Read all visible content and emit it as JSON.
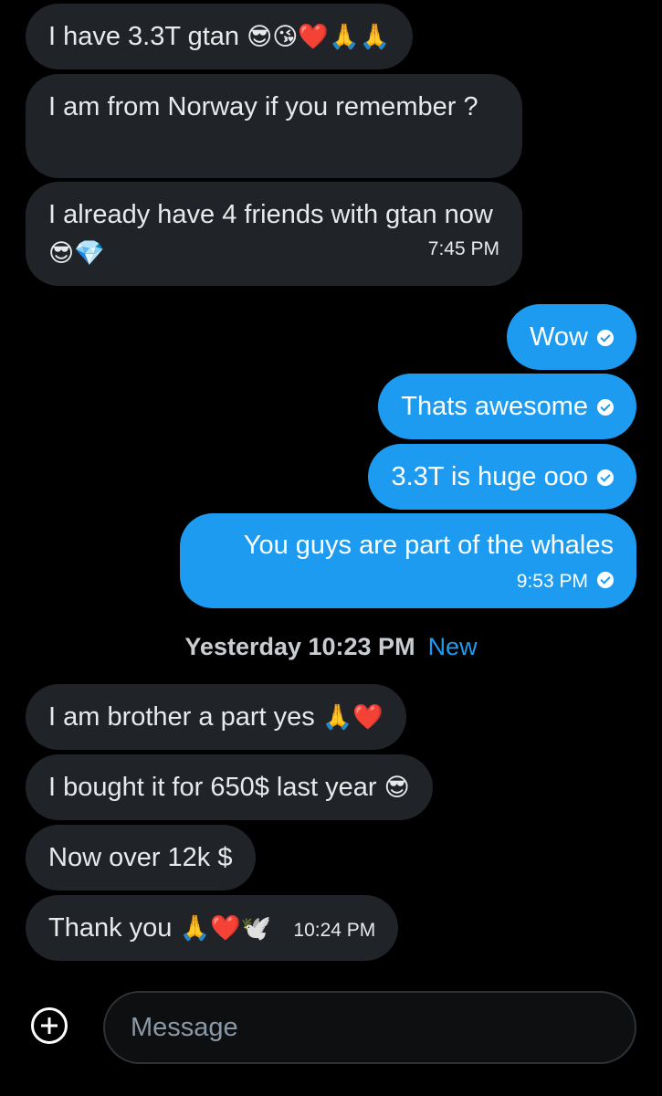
{
  "incoming_1": {
    "msg1_text": "I have 3.3T  gtan ",
    "msg1_emoji": "😎😘❤️🙏🙏",
    "msg2_text": "I am from Norway if you remember ?",
    "msg3_text": "I already have 4 friends with gtan now ",
    "msg3_emoji": "😎💎",
    "msg3_time": "7:45 PM"
  },
  "outgoing": {
    "msg1_text": "Wow",
    "msg2_text": "Thats awesome",
    "msg3_text": "3.3T is huge ooo",
    "msg4_text": "You guys are part of the whales",
    "msg4_time": "9:53 PM"
  },
  "divider": {
    "date": "Yesterday 10:23 PM",
    "new_label": "New"
  },
  "incoming_2": {
    "msg1_text": "I am brother a part yes ",
    "msg1_emoji": "🙏❤️",
    "msg2_text": "I bought it for 650$ last year ",
    "msg2_emoji": "😎",
    "msg3_text": "Now over 12k $",
    "msg4_text": "Thank you ",
    "msg4_emoji": "🙏❤️🕊️",
    "msg4_time": "10:24 PM"
  },
  "composer": {
    "placeholder": "Message",
    "value": ""
  },
  "icons": {
    "add_button": "plus-circle-icon",
    "sent_status": "check-circle-icon"
  },
  "colors": {
    "background": "#000000",
    "incoming_bubble": "#202327",
    "outgoing_bubble": "#1d9bf0",
    "new_label": "#1d9bf0"
  }
}
